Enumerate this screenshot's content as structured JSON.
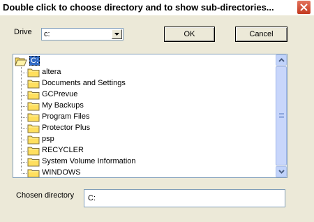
{
  "window": {
    "title": "Double click to choose directory and to show sub-directories..."
  },
  "drive": {
    "label": "Drive",
    "selected": "c:"
  },
  "buttons": {
    "ok": "OK",
    "cancel": "Cancel"
  },
  "tree": {
    "root": "C:",
    "items": [
      "altera",
      "Documents and Settings",
      "GCPrevue",
      "My Backups",
      "Program Files",
      "Protector Plus",
      "psp",
      "RECYCLER",
      "System Volume Information",
      "WINDOWS"
    ]
  },
  "chosen": {
    "label": "Chosen directory",
    "value": "C:"
  },
  "icons": {
    "close": "close-icon",
    "dropdown": "chevron-down-icon",
    "folder": "folder-icon",
    "open_folder": "open-folder-icon",
    "scroll_up": "scroll-up-icon",
    "scroll_down": "scroll-down-icon"
  },
  "colors": {
    "dialog_bg": "#ece9d8",
    "selection": "#316ac5",
    "folder": "#ffdf5e",
    "close": "#c3391f"
  }
}
